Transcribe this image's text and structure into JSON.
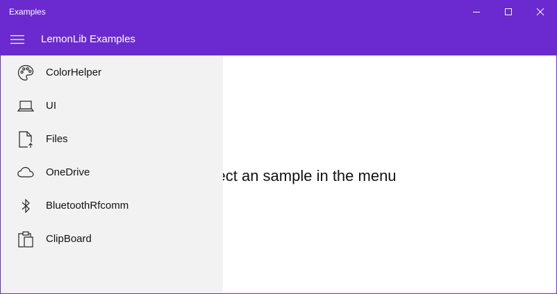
{
  "window": {
    "title": "Examples",
    "accent_color": "#6a2acf"
  },
  "caption_buttons": {
    "minimize_icon": "minimize-icon",
    "maximize_icon": "maximize-icon",
    "close_icon": "close-icon"
  },
  "header": {
    "menu_icon": "hamburger-icon",
    "title": "LemonLib Examples"
  },
  "nav": {
    "items": [
      {
        "label": "ColorHelper",
        "icon": "palette-icon"
      },
      {
        "label": "UI",
        "icon": "laptop-icon"
      },
      {
        "label": "Files",
        "icon": "file-upload-icon"
      },
      {
        "label": "OneDrive",
        "icon": "cloud-icon"
      },
      {
        "label": "BluetoothRfcomm",
        "icon": "bluetooth-icon"
      },
      {
        "label": "ClipBoard",
        "icon": "clipboard-icon"
      }
    ]
  },
  "main": {
    "message": "Please select an sample in the menu"
  }
}
